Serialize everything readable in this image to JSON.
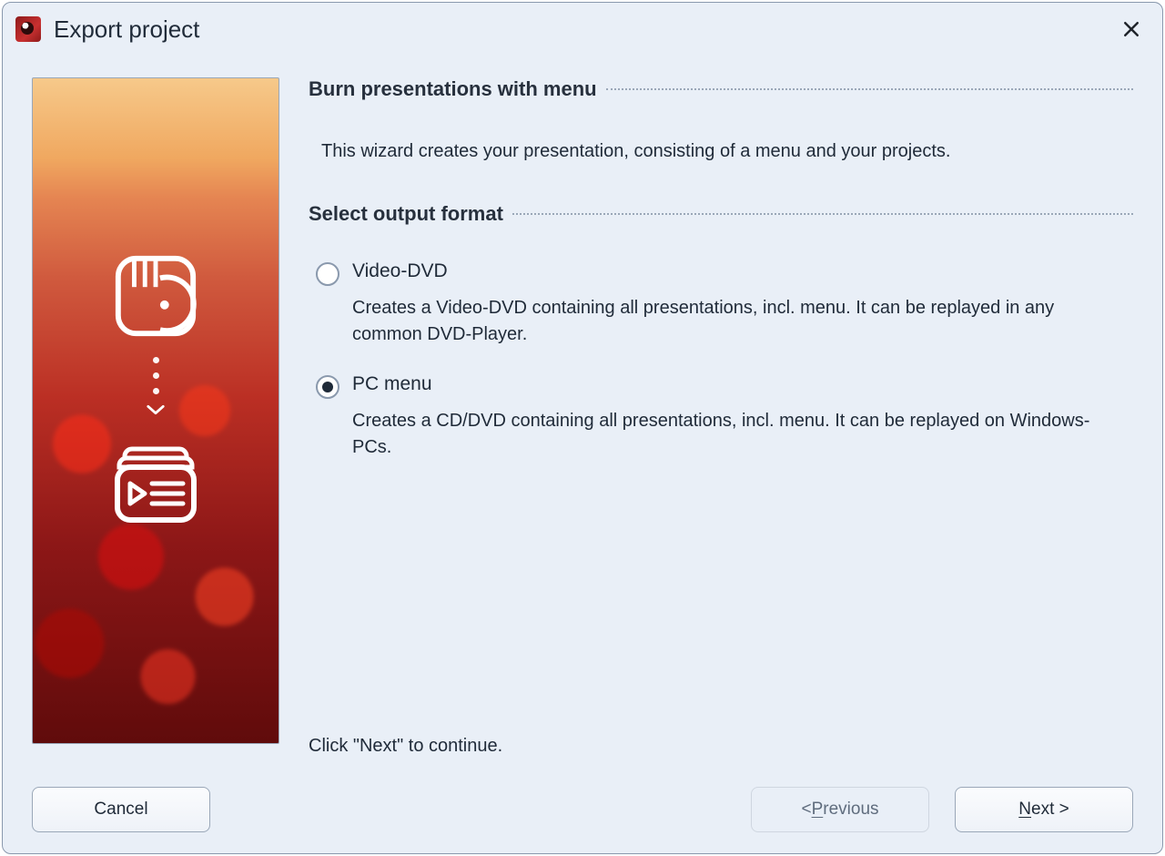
{
  "window": {
    "title": "Export project"
  },
  "sections": {
    "burn": {
      "heading": "Burn presentations with menu",
      "intro": "This wizard creates your presentation, consisting of a menu and your projects."
    },
    "format": {
      "heading": "Select output format",
      "options": [
        {
          "id": "video-dvd",
          "label": "Video-DVD",
          "description": "Creates a Video-DVD containing all presentations, incl. menu. It can be replayed in any common DVD-Player.",
          "selected": false
        },
        {
          "id": "pc-menu",
          "label": "PC menu",
          "description": "Creates a CD/DVD containing all presentations, incl. menu. It can be replayed on Windows-PCs.",
          "selected": true
        }
      ]
    }
  },
  "continue_hint": "Click \"Next\" to continue.",
  "buttons": {
    "cancel": "Cancel",
    "previous_prefix": "< ",
    "previous_ul": "P",
    "previous_rest": "revious",
    "next_ul": "N",
    "next_rest": "ext >"
  }
}
